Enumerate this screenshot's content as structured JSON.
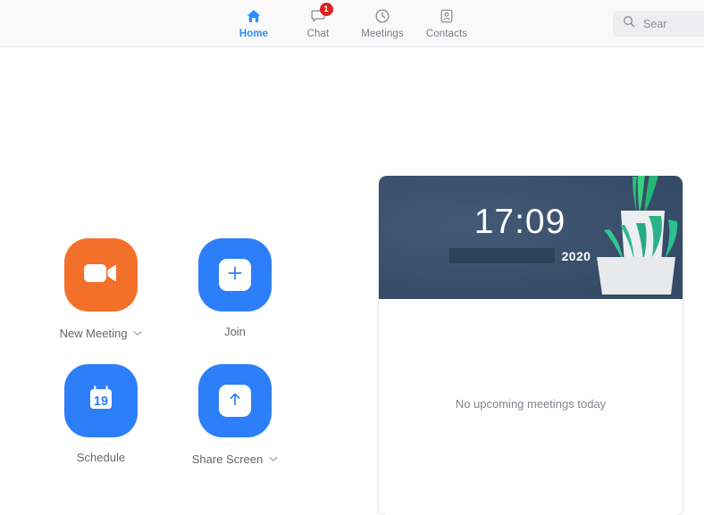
{
  "header": {
    "nav": [
      {
        "id": "home",
        "label": "Home",
        "icon": "home-icon",
        "active": true,
        "badge": null
      },
      {
        "id": "chat",
        "label": "Chat",
        "icon": "chat-icon",
        "active": false,
        "badge": "1"
      },
      {
        "id": "meetings",
        "label": "Meetings",
        "icon": "clock-icon",
        "active": false,
        "badge": null
      },
      {
        "id": "contacts",
        "label": "Contacts",
        "icon": "contacts-icon",
        "active": false,
        "badge": null
      }
    ],
    "search": {
      "icon": "search-icon",
      "text": "Sear",
      "placeholder": "Search"
    }
  },
  "main": {
    "tiles": [
      {
        "id": "new-meeting",
        "label": "New Meeting",
        "icon": "video-camera-icon",
        "color": "#f3702a",
        "chevron": true
      },
      {
        "id": "join",
        "label": "Join",
        "icon": "plus-icon",
        "color": "#2d7ff9",
        "chevron": false
      },
      {
        "id": "schedule",
        "label": "Schedule",
        "icon": "calendar-icon",
        "color": "#2d7ff9",
        "chevron": false,
        "calendar_day": "19"
      },
      {
        "id": "share-screen",
        "label": "Share Screen",
        "icon": "up-arrow-icon",
        "color": "#2d7ff9",
        "chevron": true
      }
    ],
    "meetings_card": {
      "clock": "17:09",
      "year": "2020",
      "date_redacted": true,
      "empty_message": "No upcoming meetings today",
      "hero_color": "#3a5270"
    }
  },
  "colors": {
    "accent_blue": "#2d8cff",
    "tile_blue": "#2d7ff9",
    "tile_orange": "#f3702a",
    "badge_red": "#e02020",
    "header_bg": "#f9f9fa",
    "text_gray": "#63666d"
  }
}
